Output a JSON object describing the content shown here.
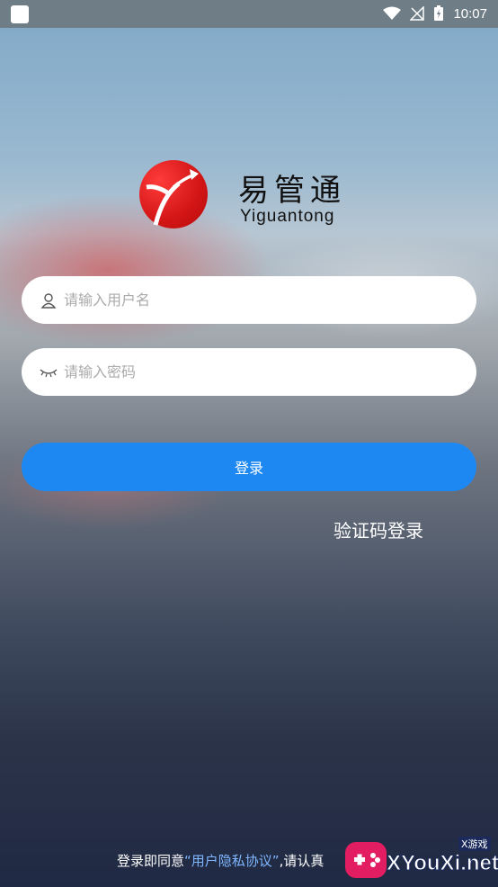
{
  "status_bar": {
    "time": "10:07"
  },
  "logo": {
    "name_cn": "易管通",
    "name_en": "Yiguantong"
  },
  "form": {
    "username_placeholder": "请输入用户名",
    "password_placeholder": "请输入密码",
    "login_label": "登录",
    "sms_login_label": "验证码登录"
  },
  "footer": {
    "prefix": "登录即同意",
    "link": "“用户隐私协议”",
    "suffix": ",请认真"
  },
  "watermark": {
    "main": "XYouXi.net",
    "small": "X游戏"
  },
  "colors": {
    "primary_button": "#1e88f2",
    "logo_red": "#d21515",
    "link_blue": "#7fb6ff"
  }
}
